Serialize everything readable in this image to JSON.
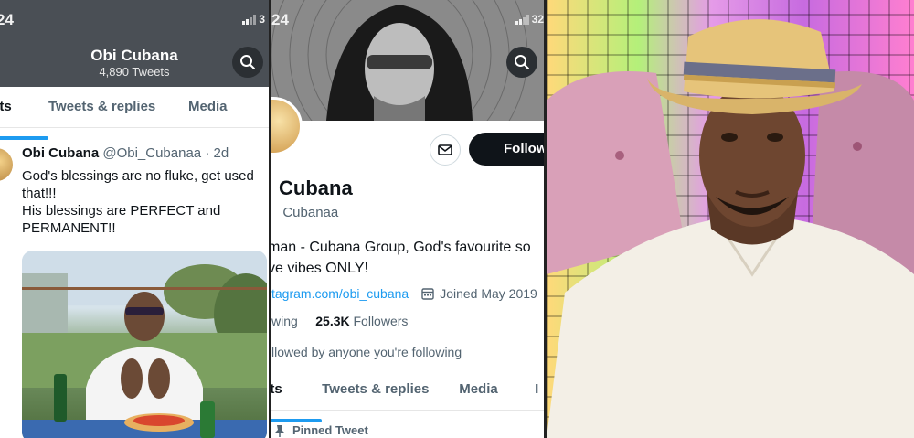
{
  "panel1": {
    "status_time": "24",
    "status_battery": "3",
    "header_title": "Obi Cubana",
    "header_count": "4,890 Tweets",
    "tabs": [
      "ets",
      "Tweets & replies",
      "Media"
    ],
    "tweet": {
      "name": "Obi Cubana",
      "handle": "@Obi_Cubanaa",
      "time": "· 2d",
      "line1": "God's blessings are no fluke, get used",
      "line2": "that!!!",
      "line3": "His blessings are PERFECT and",
      "line4": "PERMANENT!!"
    }
  },
  "panel2": {
    "status_time": "24",
    "status_battery": "32",
    "follow_label": "Follow",
    "name": "Cubana",
    "handle": "_Cubanaa",
    "bio_line1": "man - Cubana Group, God's favourite so",
    "bio_line2": "ve vibes ONLY!",
    "link": "tagram.com/obi_cubana",
    "joined": "Joined May 2019",
    "following_label": "wing",
    "followers_count": "25.3K",
    "followers_label": "Followers",
    "followed_note": "llowed by anyone you're following",
    "tabs": [
      "ets",
      "Tweets & replies",
      "Media",
      "I"
    ],
    "pinned_label": "Pinned Tweet"
  },
  "colors": {
    "twitter_blue": "#1d9bf0",
    "text_primary": "#0f1419",
    "text_secondary": "#536471",
    "header_bg": "#4a4f55"
  },
  "icons": [
    "search-icon",
    "mail-icon",
    "calendar-icon",
    "pin-icon",
    "signal-icon"
  ]
}
